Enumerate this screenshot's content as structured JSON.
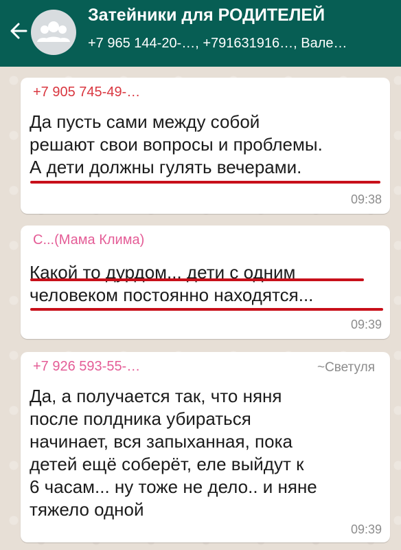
{
  "header": {
    "title": "Затейники для РОДИТЕЛЕЙ",
    "subtitle": "+7 965 144-20-…, +791631916…, Вале…",
    "icons": {
      "back": "arrow-left-icon",
      "avatar": "group-avatar-icon"
    }
  },
  "messages": [
    {
      "sender": "+7 905 745-49-…",
      "text": "Да пусть сами между собой\nрешают свои вопросы и проблемы.\nА дети должны гулять вечерами.",
      "time": "09:38"
    },
    {
      "sender": "С...(Мама Климa)",
      "text": "Какой то дурдом... дети с одним\nчеловеком постоянно находятся...",
      "time": "09:39"
    },
    {
      "sender": "+7 926 593-55-…",
      "alias": "~Светуля",
      "text": "Да, а получается так, что няня\nпосле полдника убираться\nначинает, вся запыханная, пока\nдетей ещё соберёт, еле выйдут к\n6 часам... ну тоже не дело.. и няне\nтяжело одной",
      "time": "09:39"
    }
  ],
  "colors": {
    "header": "#075e54",
    "sender_red": "#d9363f",
    "sender_pink": "#e45c96",
    "underline": "#c8101a",
    "chat_background": "#e7dfd6"
  }
}
